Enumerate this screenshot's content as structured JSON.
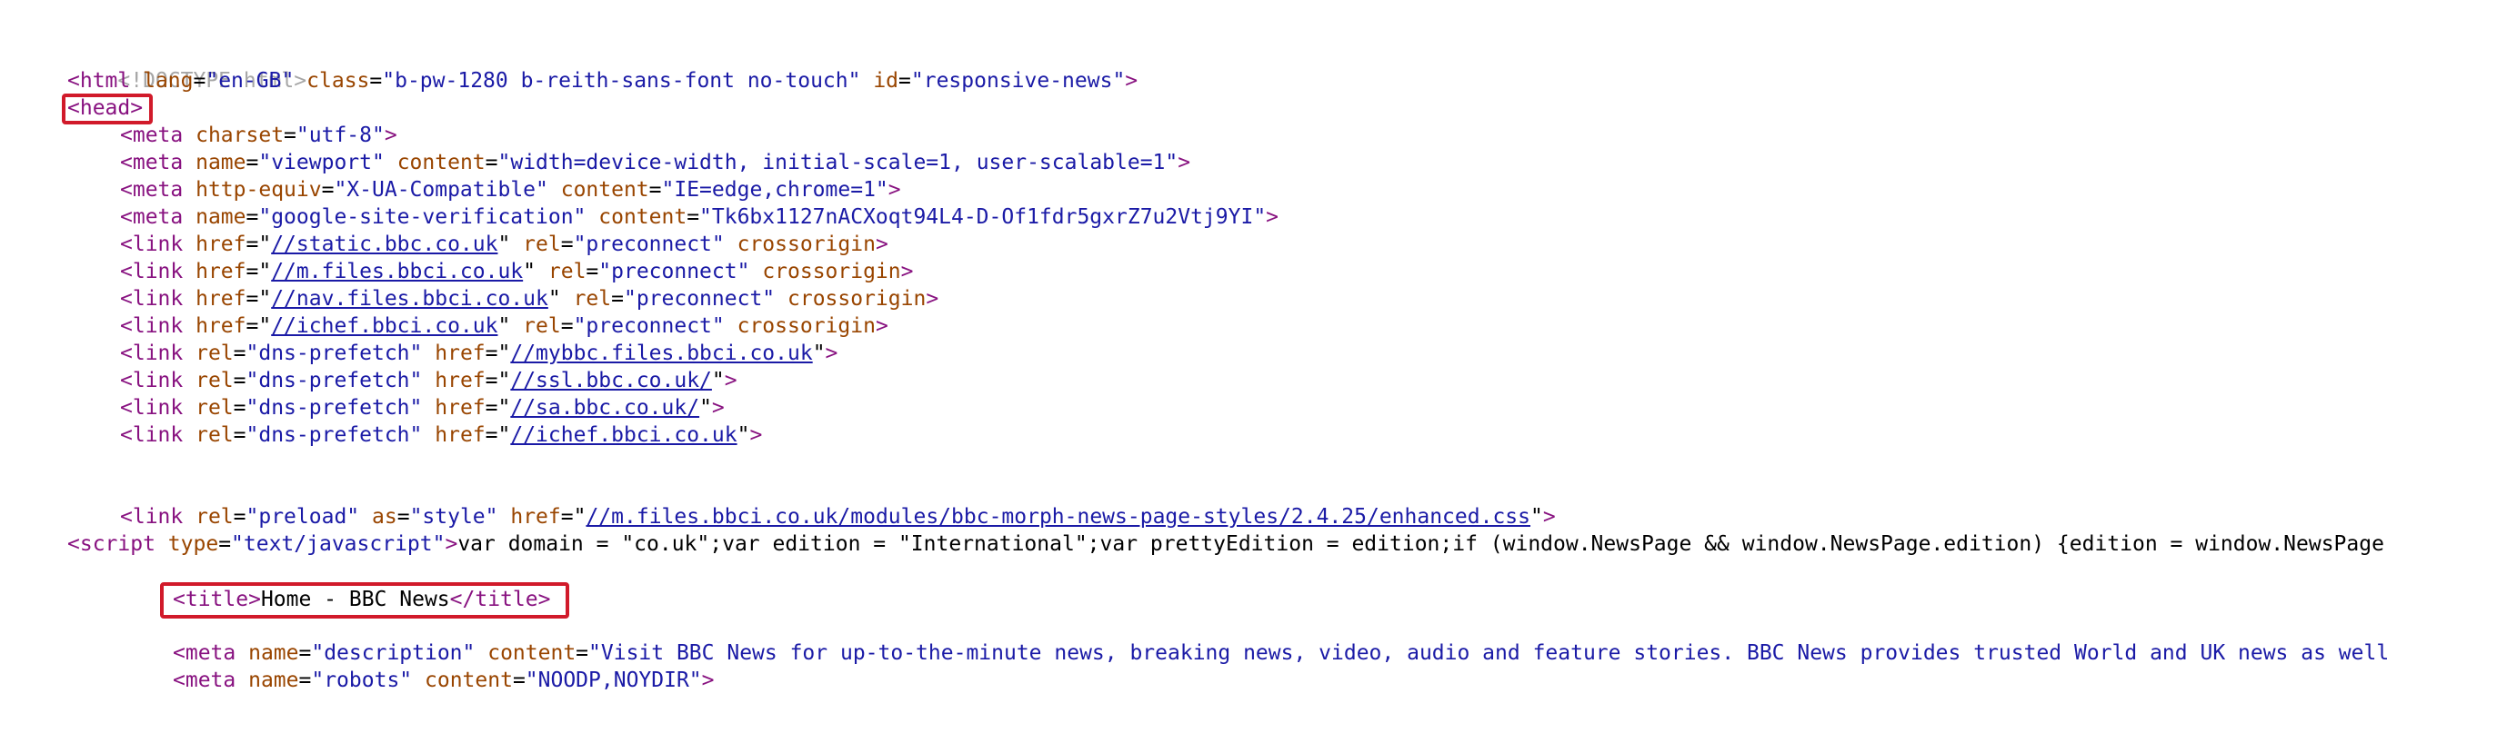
{
  "source": {
    "doctype": "<!DOCTYPE html>",
    "html_open": {
      "tag": "<html",
      "a1": "lang",
      "v1": "\"en-GB\"",
      "a2": "class",
      "v2": "\"b-pw-1280 b-reith-sans-font no-touch\"",
      "a3": "id",
      "v3": "\"responsive-news\"",
      "close": ">"
    },
    "head_open": "<head>",
    "meta_charset": {
      "tag": "<meta",
      "a1": "charset",
      "v1": "\"utf-8\"",
      "close": ">"
    },
    "meta_viewport": {
      "tag": "<meta",
      "a1": "name",
      "v1": "\"viewport\"",
      "a2": "content",
      "v2": "\"width=device-width, initial-scale=1, user-scalable=1\"",
      "close": ">"
    },
    "meta_compat": {
      "tag": "<meta",
      "a1": "http-equiv",
      "v1": "\"X-UA-Compatible\"",
      "a2": "content",
      "v2": "\"IE=edge,chrome=1\"",
      "close": ">"
    },
    "meta_verify": {
      "tag": "<meta",
      "a1": "name",
      "v1": "\"google-site-verification\"",
      "a2": "content",
      "v2": "\"Tk6bx1127nACXoqt94L4-D-Of1fdr5gxrZ7u2Vtj9YI\"",
      "close": ">"
    },
    "link_static": {
      "tag": "<link",
      "a1": "href",
      "url": "//static.bbc.co.uk",
      "a2": "rel",
      "v2": "\"preconnect\"",
      "a3": "crossorigin",
      "close": ">"
    },
    "link_mfiles": {
      "tag": "<link",
      "a1": "href",
      "url": "//m.files.bbci.co.uk",
      "a2": "rel",
      "v2": "\"preconnect\"",
      "a3": "crossorigin",
      "close": ">"
    },
    "link_nav": {
      "tag": "<link",
      "a1": "href",
      "url": "//nav.files.bbci.co.uk",
      "a2": "rel",
      "v2": "\"preconnect\"",
      "a3": "crossorigin",
      "close": ">"
    },
    "link_ichef": {
      "tag": "<link",
      "a1": "href",
      "url": "//ichef.bbci.co.uk",
      "a2": "rel",
      "v2": "\"preconnect\"",
      "a3": "crossorigin",
      "close": ">"
    },
    "dns_mybbc": {
      "tag": "<link",
      "a1": "rel",
      "v1": "\"dns-prefetch\"",
      "a2": "href",
      "url": "//mybbc.files.bbci.co.uk",
      "close": ">"
    },
    "dns_ssl": {
      "tag": "<link",
      "a1": "rel",
      "v1": "\"dns-prefetch\"",
      "a2": "href",
      "url": "//ssl.bbc.co.uk/",
      "close": ">"
    },
    "dns_sa": {
      "tag": "<link",
      "a1": "rel",
      "v1": "\"dns-prefetch\"",
      "a2": "href",
      "url": "//sa.bbc.co.uk/",
      "close": ">"
    },
    "dns_ichef": {
      "tag": "<link",
      "a1": "rel",
      "v1": "\"dns-prefetch\"",
      "a2": "href",
      "url": "//ichef.bbci.co.uk",
      "close": ">"
    },
    "preload": {
      "tag": "<link",
      "a1": "rel",
      "v1": "\"preload\"",
      "a2": "as",
      "v2": "\"style\"",
      "a3": "href",
      "url": "//m.files.bbci.co.uk/modules/bbc-morph-news-page-styles/2.4.25/enhanced.css",
      "close": ">"
    },
    "script_line": {
      "tag": "<script",
      "a1": "type",
      "v1": "\"text/javascript\"",
      "close": ">",
      "code": "var domain = \"co.uk\";var edition = \"International\";var prettyEdition = edition;if (window.NewsPage && window.NewsPage.edition) {edition = window.NewsPage"
    },
    "title_line": {
      "open": "<title>",
      "text": "Home - BBC News",
      "close": "</title>"
    },
    "meta_description": {
      "tag": "<meta",
      "a1": "name",
      "v1": "\"description\"",
      "a2": "content",
      "v2": "\"Visit BBC News for up-to-the-minute news, breaking news, video, audio and feature stories. BBC News provides trusted World and UK news as well"
    },
    "meta_robots": {
      "tag": "<meta",
      "a1": "name",
      "v1": "\"robots\"",
      "a2": "content",
      "v2": "\"NOODP,NOYDIR\"",
      "close": ">"
    }
  },
  "colors": {
    "tag": "#881280",
    "attribute": "#994500",
    "value": "#1a1aa6",
    "doctype": "#a6a6a6",
    "highlight": "#d11a2a"
  }
}
